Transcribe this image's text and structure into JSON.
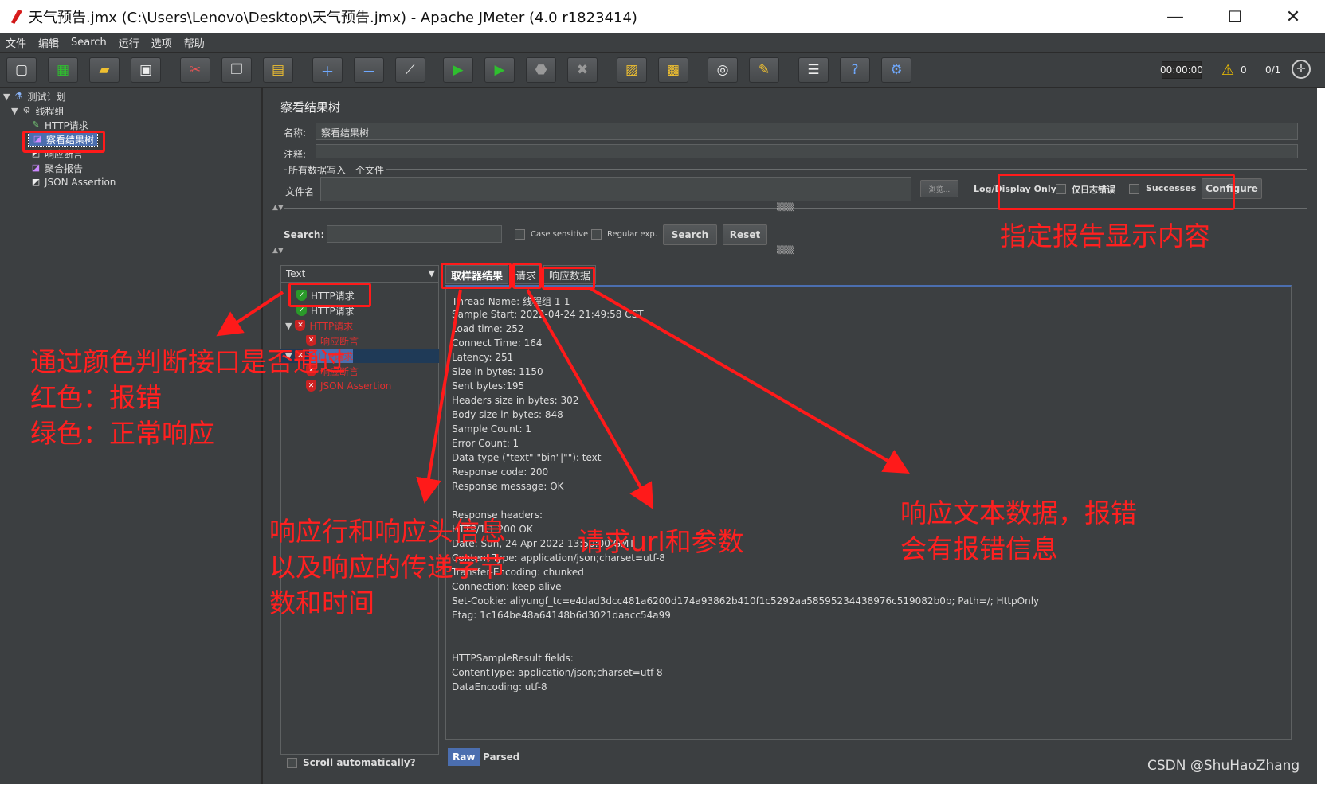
{
  "window": {
    "title": "天气预告.jmx (C:\\Users\\Lenovo\\Desktop\\天气预告.jmx) - Apache JMeter (4.0 r1823414)",
    "minimize": "—",
    "maximize": "☐",
    "close": "✕"
  },
  "menu": [
    "文件",
    "编辑",
    "Search",
    "运行",
    "选项",
    "帮助"
  ],
  "toolbar": {
    "timer": "00:00:00",
    "warning_count": "0",
    "threads": "0/1"
  },
  "tree": {
    "items": [
      {
        "label": "测试计划",
        "icon": "flask-icon"
      },
      {
        "label": "线程组",
        "icon": "gear-icon"
      },
      {
        "label": "HTTP请求",
        "icon": "pencil-icon"
      },
      {
        "label": "察看结果树",
        "icon": "chart-icon"
      },
      {
        "label": "响应断言",
        "icon": "assertion-icon"
      },
      {
        "label": "聚合报告",
        "icon": "chart-icon"
      },
      {
        "label": "JSON Assertion",
        "icon": "assertion-icon"
      }
    ]
  },
  "panel": {
    "title": "察看结果树",
    "name_label": "名称:",
    "name_value": "察看结果树",
    "comment_label": "注释:",
    "file_group_title": "所有数据写入一个文件",
    "filename_label": "文件名",
    "browse_label": "浏览...",
    "log_display_label": "Log/Display Only:",
    "errors_label": "仅日志错误",
    "successes_label": "Successes",
    "configure_label": "Configure"
  },
  "search": {
    "label": "Search:",
    "case_sensitive": "Case sensitive",
    "regular_exp": "Regular exp.",
    "search_button": "Search",
    "reset_button": "Reset"
  },
  "results": {
    "renderer": "Text",
    "nodes": [
      {
        "label": "HTTP请求",
        "status": "ok",
        "level": 0
      },
      {
        "label": "HTTP请求",
        "status": "ok",
        "level": 0
      },
      {
        "label": "HTTP请求",
        "status": "error",
        "level": 0
      },
      {
        "label": "响应断言",
        "status": "error",
        "level": 1
      },
      {
        "label": "HTTP请求",
        "status": "error",
        "level": 0
      },
      {
        "label": "响应断言",
        "status": "error",
        "level": 1
      },
      {
        "label": "JSON Assertion",
        "status": "error",
        "level": 1
      }
    ],
    "scroll_auto": "Scroll automatically?"
  },
  "tabs": [
    "取样器结果",
    "请求",
    "响应数据"
  ],
  "detail_lines": [
    "Thread Name: 线程组 1-1",
    "Sample Start: 2022-04-24 21:49:58 CST",
    "Load time: 252",
    "Connect Time: 164",
    "Latency: 251",
    "Size in bytes: 1150",
    "Sent bytes:195",
    "Headers size in bytes: 302",
    "Body size in bytes: 848",
    "Sample Count: 1",
    "Error Count: 1",
    "Data type (\"text\"|\"bin\"|\"\"): text",
    "Response code: 200",
    "Response message: OK",
    "",
    "Response headers:",
    "HTTP/1.1 200 OK",
    "Date: Sun, 24 Apr 2022 13:50:00 GMT",
    "Content-Type: application/json;charset=utf-8",
    "Transfer-Encoding: chunked",
    "Connection: keep-alive",
    "Set-Cookie: aliyungf_tc=e4dad3dcc481a6200d174a93862b410f1c5292aa58595234438976c519082b0b; Path=/; HttpOnly",
    "Etag: 1c164be48a64148b6d3021daacc54a99",
    "",
    "",
    "HTTPSampleResult fields:",
    "ContentType: application/json;charset=utf-8",
    "DataEncoding: utf-8"
  ],
  "subtabs": [
    "Raw",
    "Parsed"
  ],
  "annotations": {
    "report_content": "指定报告显示内容",
    "color_line1": "通过颜色判断接口是否通过",
    "color_line2": "红色：报错",
    "color_line3": "绿色：正常响应",
    "headers_line1": "响应行和响应头信息",
    "headers_line2": "以及响应的传递字节",
    "headers_line3": "数和时间",
    "url_params": "请求url和参数",
    "resp_line1": "响应文本数据，报错",
    "resp_line2": "会有报错信息"
  },
  "watermark": "CSDN @ShuHaoZhang",
  "colors": {
    "annotation": "#ff1a1a",
    "ok": "#2a9a2a",
    "error": "#e03030",
    "selection": "#4b6eaf"
  }
}
